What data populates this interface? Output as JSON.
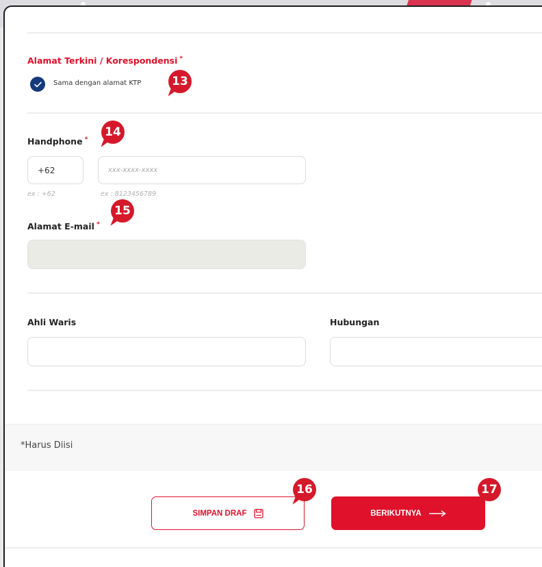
{
  "address": {
    "title": "Alamat Terkini / Korespondensi",
    "required_mark": "*",
    "same_as_ktp_label": "Sama dengan alamat KTP",
    "same_as_ktp_checked": true
  },
  "phone": {
    "title": "Handphone",
    "required_mark": "*",
    "country_code_value": "+62",
    "number_placeholder": "xxx-xxxx-xxxx",
    "country_code_hint": "ex : +62",
    "number_hint": "ex : 8123456789"
  },
  "email": {
    "title": "Alamat E-mail",
    "required_mark": "*",
    "value": ""
  },
  "heir": {
    "title": "Ahli Waris",
    "value": ""
  },
  "relationship": {
    "title": "Hubungan",
    "value": ""
  },
  "footer": {
    "required_note": "*Harus Diisi"
  },
  "actions": {
    "save_draft_label": "SIMPAN DRAF",
    "next_label": "BERIKUTNYA"
  },
  "badges": {
    "b13": "13",
    "b14": "14",
    "b15": "15",
    "b16": "16",
    "b17": "17"
  },
  "colors": {
    "accent": "#e0112b",
    "checkbox": "#143a7b",
    "badge": "#d5192b"
  }
}
